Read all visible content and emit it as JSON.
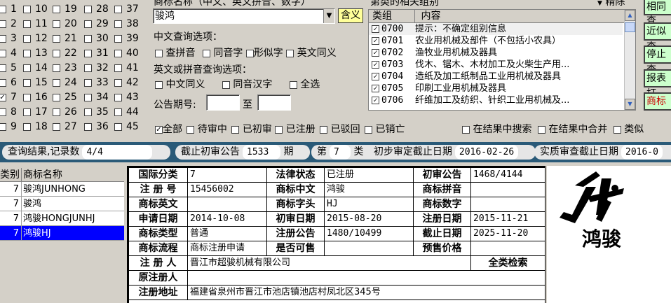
{
  "numbers": {
    "col1": [
      "1",
      "2",
      "3",
      "4",
      "5",
      "6",
      "7",
      "8",
      "9"
    ],
    "col1_checked": [
      false,
      false,
      false,
      false,
      false,
      false,
      true,
      false,
      false
    ],
    "col2": [
      "10",
      "11",
      "12",
      "13",
      "14",
      "15",
      "16",
      "17",
      "18"
    ],
    "col3": [
      "19",
      "20",
      "21",
      "22",
      "23",
      "24",
      "25",
      "26",
      "27"
    ],
    "col4": [
      "28",
      "29",
      "30",
      "31",
      "32",
      "33",
      "34",
      "35",
      "36"
    ],
    "col5": [
      "37",
      "38",
      "39",
      "40",
      "41",
      "42",
      "43",
      "44",
      "45"
    ]
  },
  "search": {
    "header": "商标名称（中文、英文拼音、数字）",
    "value": "骏鸿",
    "include_button": "含义",
    "cn_options_label": "中文查询选项：",
    "cn_options": [
      "查拼音",
      "同音字",
      "形似字",
      "英文同义"
    ],
    "en_options_label": "英文或拼音查询选项：",
    "en_options": [
      "中文同义",
      "同音汉字",
      "全选"
    ],
    "period_label": "公告期号:",
    "period_to": "至",
    "status_options": [
      "全部",
      "待审中",
      "已初审",
      "已注册",
      "已驳回",
      "已销亡"
    ],
    "extra_options": [
      "在结果中搜索",
      "在结果中合并",
      "类似"
    ]
  },
  "category": {
    "header": "第类的相关组别",
    "remove_label": "精除",
    "col_group": "类组",
    "col_content": "内容",
    "rows": [
      {
        "code": "0700",
        "text": "提示：不确定组别信息"
      },
      {
        "code": "0701",
        "text": "农业用机械及部件（不包括小农具）"
      },
      {
        "code": "0702",
        "text": "渔牧业用机械及器具"
      },
      {
        "code": "0703",
        "text": "伐木、锯木、木材加工及火柴生产用..."
      },
      {
        "code": "0704",
        "text": "造纸及加工纸制品工业用机械及器具"
      },
      {
        "code": "0705",
        "text": "印刷工业用机械及器具"
      },
      {
        "code": "0706",
        "text": "纤维加工及纺织、针织工业用机械及..."
      }
    ]
  },
  "right_buttons": [
    "相同查",
    "近似查",
    "停止查",
    "报表打",
    "商标"
  ],
  "status": {
    "result_label": "查询结果,记录数",
    "result_value": "4/4",
    "deadline_label": "截止初审公告",
    "deadline_value": "1533",
    "deadline_unit": "期",
    "class_prefix": "第",
    "class_value": "7",
    "class_suffix": "类",
    "prelim_label": "初步审定截止日期",
    "prelim_value": "2016-02-26",
    "substantive_label": "实质审查截止日期",
    "substantive_value": "2016-0"
  },
  "results": {
    "col_class": "类别",
    "col_name": "商标名称",
    "rows": [
      {
        "class": "7",
        "name": "骏鸿JUNHONG"
      },
      {
        "class": "7",
        "name": "骏鸿"
      },
      {
        "class": "7",
        "name": "鸿骏HONGJUNHJ"
      },
      {
        "class": "7",
        "name": "鸿骏HJ"
      }
    ]
  },
  "detail": {
    "k_intl_class": "国际分类",
    "v_intl_class": "7",
    "k_legal": "法律状态",
    "v_legal": "已注册",
    "k_prelim_pub": "初审公告",
    "v_prelim_pub": "1468/4144",
    "k_reg_no": "注 册 号",
    "v_reg_no": "15456002",
    "k_cn": "商标中文",
    "v_cn": "鸿骏",
    "k_pinyin": "商标拼音",
    "v_pinyin": "",
    "k_en": "商标英文",
    "v_en": "",
    "k_head": "商标字头",
    "v_head": "HJ",
    "k_digit": "商标数字",
    "v_digit": "",
    "k_apply": "申请日期",
    "v_apply": "2014-10-08",
    "k_prelim_date": "初审日期",
    "v_prelim_date": "2015-08-20",
    "k_reg_date": "注册日期",
    "v_reg_date": "2015-11-21",
    "k_type": "商标类型",
    "v_type": "普通",
    "k_reg_pub": "注册公告",
    "v_reg_pub": "1480/10499",
    "k_expire": "截止日期",
    "v_expire": "2025-11-20",
    "k_flow": "商标流程",
    "v_flow": "商标注册申请",
    "k_shared": "是否可售",
    "v_shared": "",
    "k_presale": "预售价格",
    "v_presale": "",
    "k_registrant": "注 册 人",
    "v_registrant": "晋江市超骏机械有限公司",
    "all_class_search": "全类检索",
    "k_orig": "原注册人",
    "v_orig": "",
    "k_addr": "注册地址",
    "v_addr": "福建省泉州市晋江市池店镇池店村凤北区345号"
  },
  "logo": {
    "brand_text": "鸿骏",
    "mark_text": "HJ"
  }
}
